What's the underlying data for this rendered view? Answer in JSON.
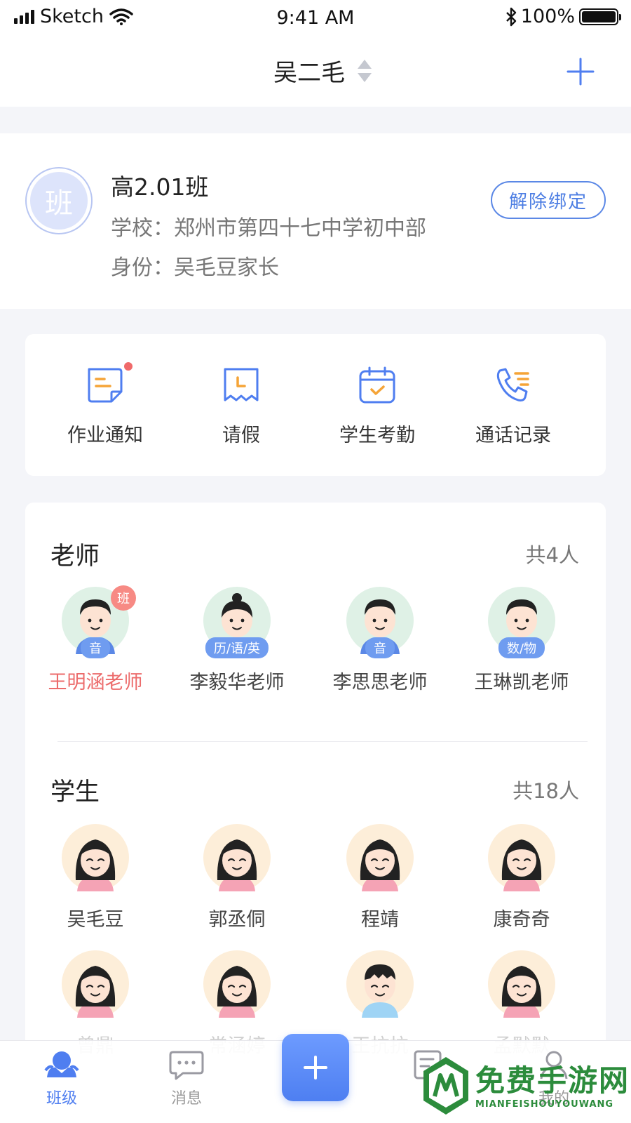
{
  "status_bar": {
    "carrier": "Sketch",
    "time": "9:41 AM",
    "battery": "100%",
    "battery_level": 1.0
  },
  "nav": {
    "title": "吴二毛"
  },
  "class_info": {
    "avatar_text": "班",
    "name": "高2.01班",
    "school": "学校：郑州市第四十七中学初中部",
    "role": "身份：吴毛豆家长",
    "unbind_label": "解除绑定"
  },
  "functions": [
    {
      "label": "作业通知",
      "icon": "homework-notice-icon",
      "has_badge": true
    },
    {
      "label": "请假",
      "icon": "leave-request-icon",
      "has_badge": false
    },
    {
      "label": "学生考勤",
      "icon": "calendar-attendance-icon",
      "has_badge": false
    },
    {
      "label": "通话记录",
      "icon": "phone-log-icon",
      "has_badge": false
    }
  ],
  "teachers": {
    "title": "老师",
    "count": "共4人",
    "items": [
      {
        "name": "王明涵老师",
        "subject": "音",
        "class_badge": "班",
        "active": true
      },
      {
        "name": "李毅华老师",
        "subject": "历/语/英",
        "active": false
      },
      {
        "name": "李思思老师",
        "subject": "音",
        "active": false
      },
      {
        "name": "王琳凯老师",
        "subject": "数/物",
        "active": false
      }
    ]
  },
  "students": {
    "title": "学生",
    "count": "共18人",
    "items": [
      {
        "name": "吴毛豆"
      },
      {
        "name": "郭丞侗"
      },
      {
        "name": "程靖"
      },
      {
        "name": "康奇奇"
      },
      {
        "name": "曾鼎"
      },
      {
        "name": "常涵婷"
      },
      {
        "name": "王抗抗"
      },
      {
        "name": "孟默默"
      }
    ]
  },
  "tab_bar": {
    "items": [
      {
        "label": "班级",
        "icon": "class-icon",
        "active": true
      },
      {
        "label": "消息",
        "icon": "message-icon",
        "active": false
      },
      {
        "label": "",
        "icon": "plus-icon",
        "active": false
      },
      {
        "label": "",
        "icon": "document-icon",
        "active": false
      },
      {
        "label": "我的",
        "icon": "profile-icon",
        "active": false
      }
    ]
  },
  "watermark": {
    "cn": "免费手游网",
    "en": "MIANFEISHOUYOUWANG"
  },
  "colors": {
    "accent": "#4f7ef0",
    "active_name": "#ec6b6b",
    "badge": "#f78a84",
    "teacher_bg": "#dff1e6",
    "student_bg": "#fdeed9"
  }
}
